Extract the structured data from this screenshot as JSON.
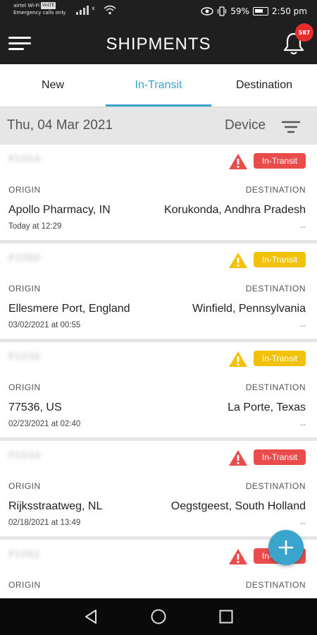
{
  "status_bar": {
    "carrier_line1": "airtel Wi-Fi",
    "carrier_badge": "VoLTE",
    "carrier_line2": "Emergency calls only",
    "battery": "59%",
    "time": "2:50 pm"
  },
  "app_bar": {
    "title": "SHIPMENTS",
    "notification_count": "587"
  },
  "tabs": [
    {
      "label": "New",
      "active": false
    },
    {
      "label": "In-Transit",
      "active": true
    },
    {
      "label": "Destination",
      "active": false
    }
  ],
  "filter": {
    "date": "Thu, 04 Mar 2021",
    "device_label": "Device"
  },
  "labels": {
    "origin": "ORIGIN",
    "destination": "DESTINATION"
  },
  "shipments": [
    {
      "id": "P1054",
      "status": "In-Transit",
      "severity": "red",
      "origin": "Apollo Pharmacy, IN",
      "destination": "Korukonda, Andhra Pradesh",
      "timestamp": "Today at 12:29",
      "eta": "--"
    },
    {
      "id": "P1080",
      "status": "In-Transit",
      "severity": "yellow",
      "origin": "Ellesmere Port, England",
      "destination": "Winfield, Pennsylvania",
      "timestamp": "03/02/2021 at 00:55",
      "eta": "--"
    },
    {
      "id": "P1036",
      "status": "In-Transit",
      "severity": "yellow",
      "origin": "77536, US",
      "destination": "La Porte, Texas",
      "timestamp": "02/23/2021 at 02:40",
      "eta": "--"
    },
    {
      "id": "P1034",
      "status": "In-Transit",
      "severity": "red",
      "origin": "Rijksstraatweg, NL",
      "destination": "Oegstgeest, South Holland",
      "timestamp": "02/18/2021 at 13:49",
      "eta": "--"
    },
    {
      "id": "P1062",
      "status": "In-Transit",
      "severity": "red",
      "origin": "",
      "destination": "",
      "timestamp": "",
      "eta": ""
    }
  ],
  "colors": {
    "accent": "#3aa4cc",
    "alert_red": "#ea4b4b",
    "alert_yellow": "#f2c20b",
    "app_bar": "#1f1f1f"
  }
}
